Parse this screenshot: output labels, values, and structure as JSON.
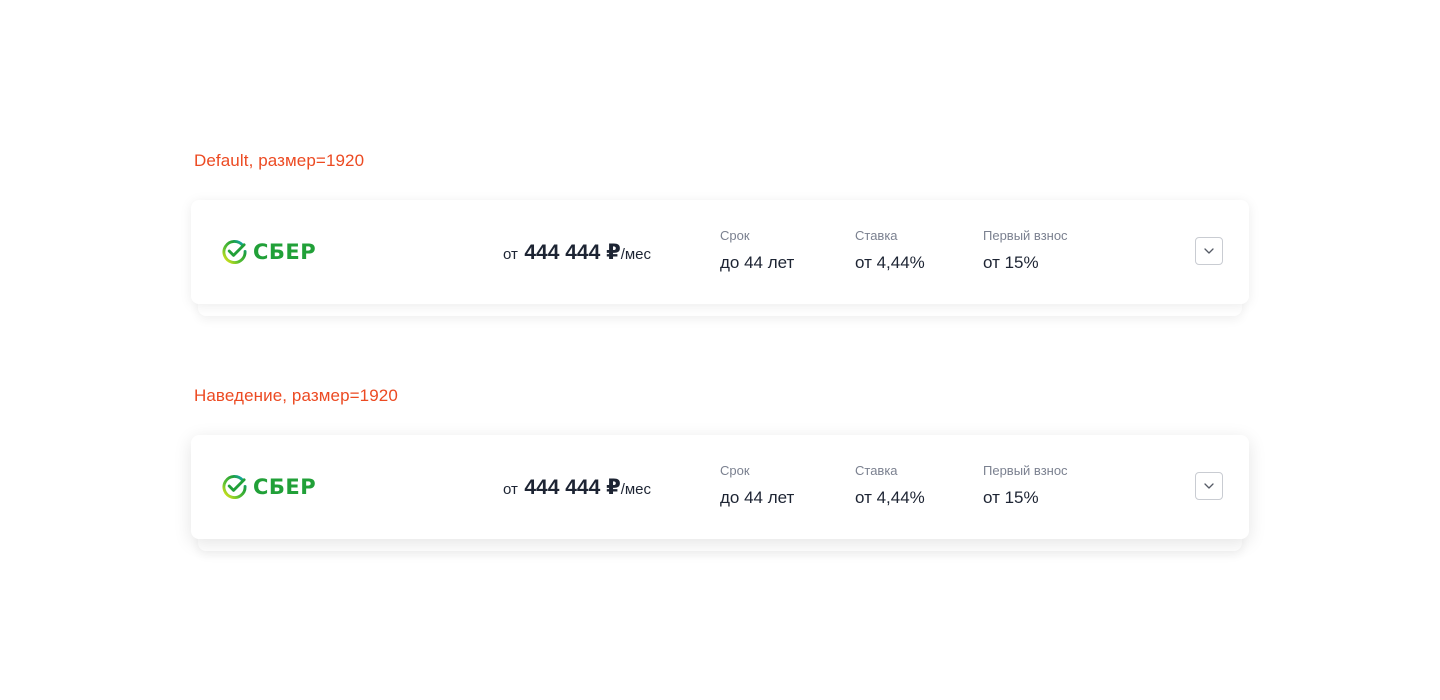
{
  "variants": [
    {
      "label": "Default, размер=1920",
      "card": {
        "logo_text": "СБЕР",
        "price": {
          "prefix": "от",
          "amount": "444 444 ₽",
          "suffix": "/мес"
        },
        "term": {
          "label": "Срок",
          "value": "до 44 лет"
        },
        "rate": {
          "label": "Ставка",
          "value": "от 4,44%"
        },
        "down_payment": {
          "label": "Первый взнос",
          "value": "от 15%"
        },
        "expand_icon": "chevron-down-icon"
      }
    },
    {
      "label": "Наведение, размер=1920",
      "card": {
        "logo_text": "СБЕР",
        "price": {
          "prefix": "от",
          "amount": "444 444 ₽",
          "suffix": "/мес"
        },
        "term": {
          "label": "Срок",
          "value": "до 44 лет"
        },
        "rate": {
          "label": "Ставка",
          "value": "от 4,44%"
        },
        "down_payment": {
          "label": "Первый взнос",
          "value": "от 15%"
        },
        "expand_icon": "chevron-down-icon"
      }
    }
  ],
  "colors": {
    "label_accent": "#ec4a22",
    "brand_green": "#21a038",
    "text_primary": "#1d2433",
    "text_secondary": "#7b8190"
  }
}
